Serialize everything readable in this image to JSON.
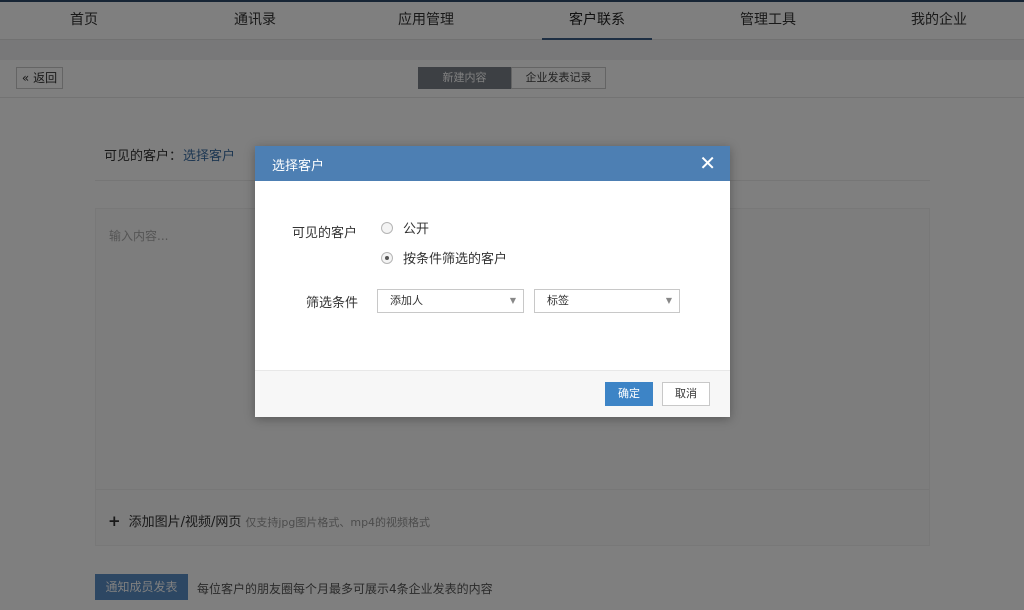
{
  "nav": {
    "items": [
      {
        "label": "首页"
      },
      {
        "label": "通讯录"
      },
      {
        "label": "应用管理"
      },
      {
        "label": "客户联系",
        "active": true
      },
      {
        "label": "管理工具"
      },
      {
        "label": "我的企业"
      }
    ]
  },
  "toolbar": {
    "back_label": "返回",
    "segments": [
      {
        "label": "新建内容",
        "selected": true
      },
      {
        "label": "企业发表记录",
        "selected": false
      }
    ]
  },
  "form": {
    "visible_label": "可见的客户：",
    "visible_link": "选择客户",
    "content_placeholder": "输入内容...",
    "add_media_label": "添加图片/视频/网页",
    "add_media_hint": "仅支持jpg图片格式、mp4的视频格式",
    "notify_button": "通知成员发表",
    "notify_hint": "每位客户的朋友圈每个月最多可展示4条企业发表的内容"
  },
  "modal": {
    "title": "选择客户",
    "visible_label": "可见的客户",
    "options": [
      {
        "label": "公开",
        "checked": false
      },
      {
        "label": "按条件筛选的客户",
        "checked": true
      }
    ],
    "filter_label": "筛选条件",
    "filter_adder": "添加人",
    "filter_tag": "标签",
    "confirm_label": "确定",
    "cancel_label": "取消"
  },
  "colors": {
    "header_blue": "#4d7fb3",
    "primary_button": "#3d84c6",
    "notify_button": "#5b8fc6",
    "nav_accent": "#3c5f86"
  },
  "icons": {
    "back": "double-chevron-left-icon",
    "close": "close-icon",
    "add": "plus-icon",
    "dropdown": "caret-down-icon"
  }
}
